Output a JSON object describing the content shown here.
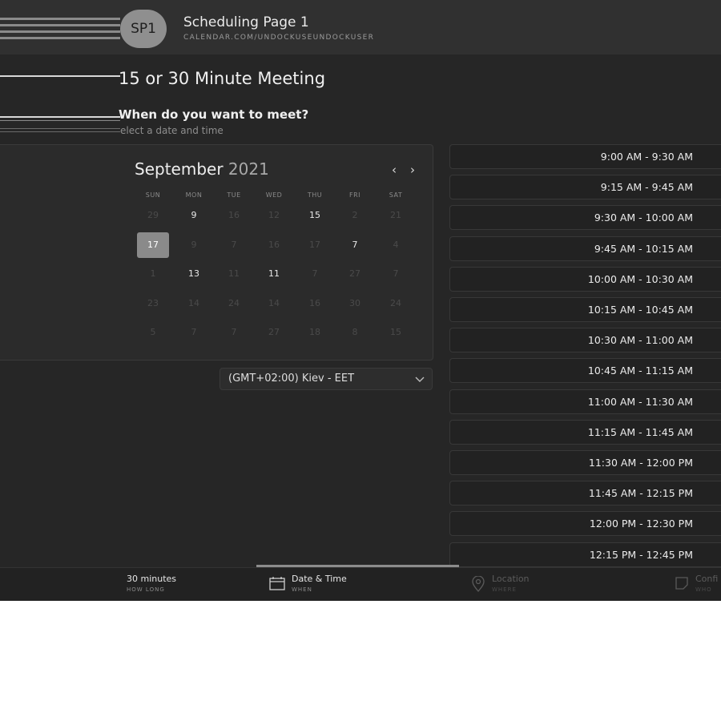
{
  "header": {
    "avatar_initials": "SP1",
    "title": "Scheduling Page 1",
    "url": "CALENDAR.COM/UNDOCKUSEUNDOCKUSER"
  },
  "intro": {
    "meeting_title": "15 or 30 Minute Meeting",
    "question": "When do you want to meet?",
    "hint": "elect a date and time"
  },
  "calendar": {
    "month": "September",
    "year": "2021",
    "prev_icon": "chevron-left-icon",
    "next_icon": "chevron-right-icon",
    "weekdays": [
      "SUN",
      "MON",
      "TUE",
      "WED",
      "THU",
      "FRI",
      "SAT"
    ],
    "weeks": [
      [
        {
          "d": "29",
          "a": false
        },
        {
          "d": "9",
          "a": true
        },
        {
          "d": "16",
          "a": false
        },
        {
          "d": "12",
          "a": false
        },
        {
          "d": "15",
          "a": true
        },
        {
          "d": "2",
          "a": false
        },
        {
          "d": "21",
          "a": false
        }
      ],
      [
        {
          "d": "17",
          "a": true,
          "sel": true
        },
        {
          "d": "9",
          "a": false
        },
        {
          "d": "7",
          "a": false
        },
        {
          "d": "16",
          "a": false
        },
        {
          "d": "17",
          "a": false
        },
        {
          "d": "7",
          "a": true
        },
        {
          "d": "4",
          "a": false
        }
      ],
      [
        {
          "d": "1",
          "a": false
        },
        {
          "d": "13",
          "a": true
        },
        {
          "d": "11",
          "a": false
        },
        {
          "d": "11",
          "a": true
        },
        {
          "d": "7",
          "a": false
        },
        {
          "d": "27",
          "a": false
        },
        {
          "d": "7",
          "a": false
        }
      ],
      [
        {
          "d": "23",
          "a": false
        },
        {
          "d": "14",
          "a": false
        },
        {
          "d": "24",
          "a": false
        },
        {
          "d": "14",
          "a": false
        },
        {
          "d": "16",
          "a": false
        },
        {
          "d": "30",
          "a": false
        },
        {
          "d": "24",
          "a": false
        }
      ],
      [
        {
          "d": "5",
          "a": false
        },
        {
          "d": "7",
          "a": false
        },
        {
          "d": "7",
          "a": false
        },
        {
          "d": "27",
          "a": false
        },
        {
          "d": "18",
          "a": false
        },
        {
          "d": "8",
          "a": false
        },
        {
          "d": "15",
          "a": false
        }
      ]
    ]
  },
  "timezone": {
    "label": "(GMT+02:00) Kiev - EET",
    "icon": "chevron-down-icon"
  },
  "time_slots": [
    "9:00 AM - 9:30 AM",
    "9:15 AM - 9:45 AM",
    "9:30 AM - 10:00 AM",
    "9:45 AM - 10:15 AM",
    "10:00 AM - 10:30 AM",
    "10:15 AM - 10:45 AM",
    "10:30 AM - 11:00 AM",
    "10:45 AM - 11:15 AM",
    "11:00 AM - 11:30 AM",
    "11:15 AM - 11:45 AM",
    "11:30 AM - 12:00 PM",
    "11:45 AM - 12:15 PM",
    "12:00 PM - 12:30 PM",
    "12:15 PM - 12:45 PM"
  ],
  "steps": {
    "duration": {
      "label": "30 minutes",
      "sub": "HOW LONG"
    },
    "datetime": {
      "label": "Date & Time",
      "sub": "WHEN",
      "icon": "calendar-icon"
    },
    "location": {
      "label": "Location",
      "sub": "WHERE",
      "icon": "location-pin-icon"
    },
    "confirm": {
      "label": "Confi",
      "sub": "WHO",
      "icon": "confirm-icon"
    }
  },
  "colors": {
    "background": "#262626",
    "header": "#303030",
    "selected_day": "#8a8a8a",
    "slot_border": "#383838"
  }
}
